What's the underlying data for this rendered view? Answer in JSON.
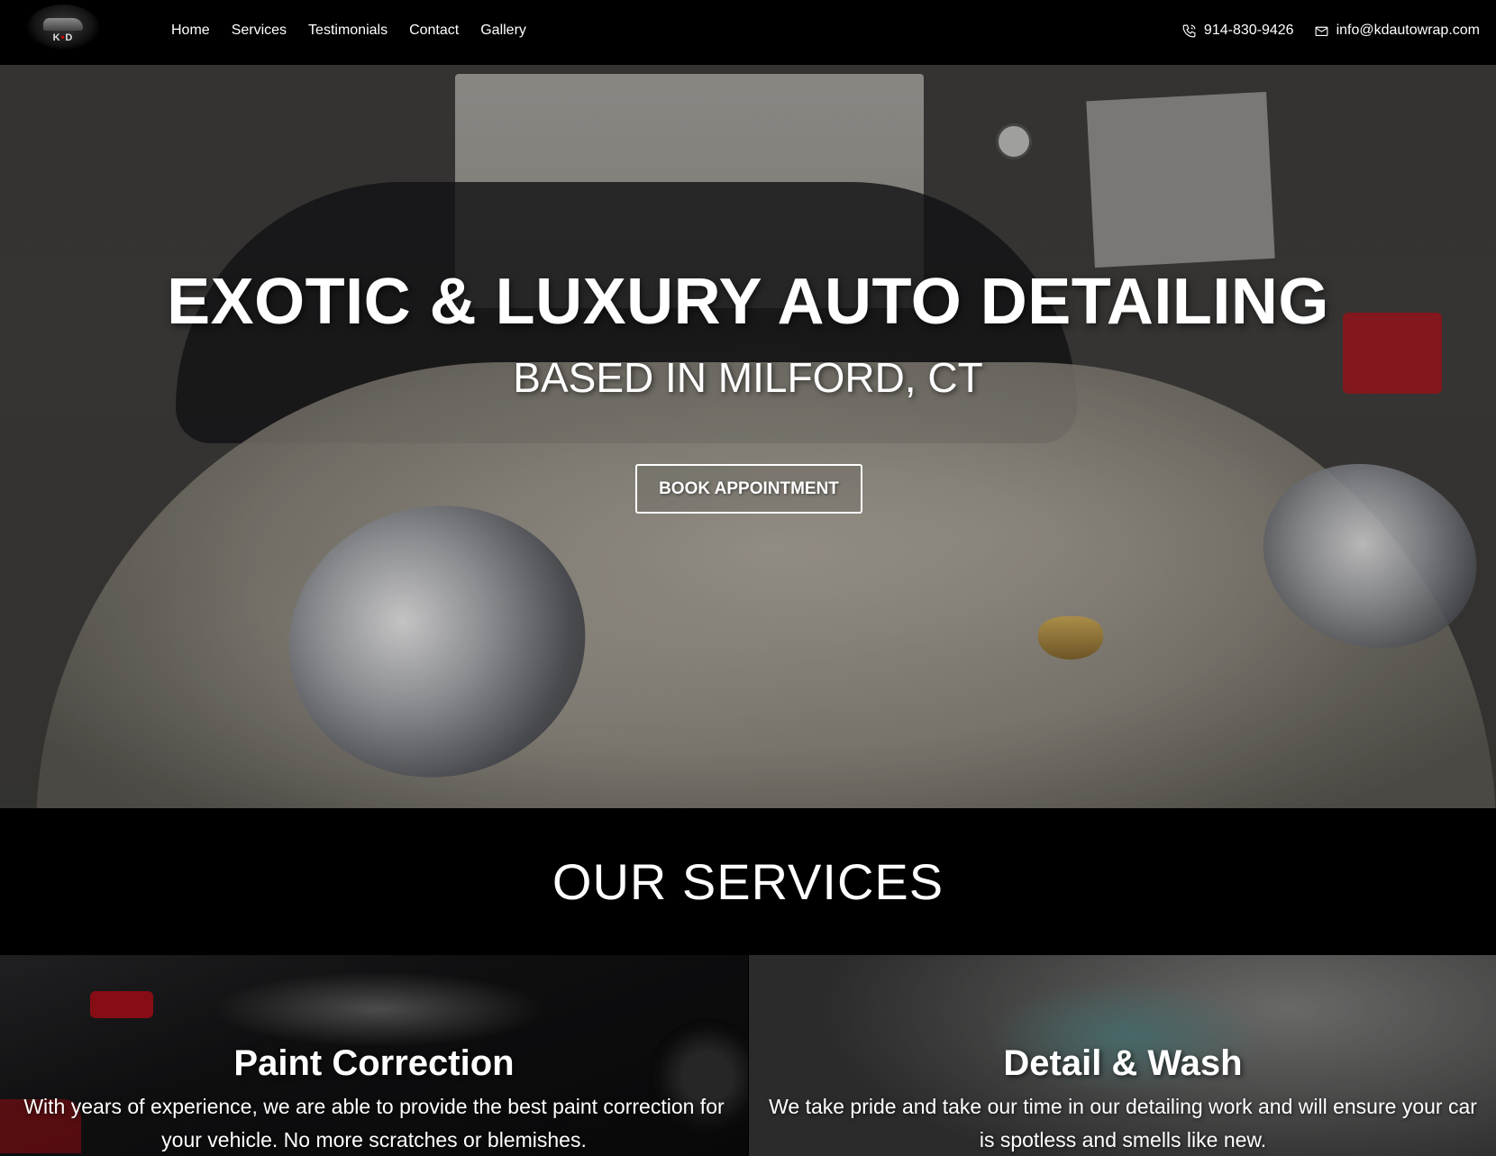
{
  "header": {
    "logo_text_left": "K",
    "logo_text_mid": "•",
    "logo_text_right": "D",
    "nav": [
      "Home",
      "Services",
      "Testimonials",
      "Contact",
      "Gallery"
    ],
    "phone": "914-830-9426",
    "email": "info@kdautowrap.com"
  },
  "hero": {
    "title": "EXOTIC & LUXURY AUTO DETAILING",
    "subtitle": "BASED IN MILFORD, CT",
    "cta_label": "BOOK APPOINTMENT"
  },
  "services": {
    "heading": "OUR SERVICES",
    "cards": [
      {
        "title": "Paint Correction",
        "text": "With years of experience, we are able to provide the best paint correction for your vehicle. No more scratches or blemishes."
      },
      {
        "title": "Detail & Wash",
        "text": "We take pride and take our time in our detailing work and will ensure your car is spotless and smells like new."
      }
    ]
  },
  "colors": {
    "header_bg": "#000000",
    "text": "#ffffff",
    "accent_red": "#c5111c"
  },
  "icons": {
    "phone": "phone-icon",
    "email": "envelope-icon"
  }
}
